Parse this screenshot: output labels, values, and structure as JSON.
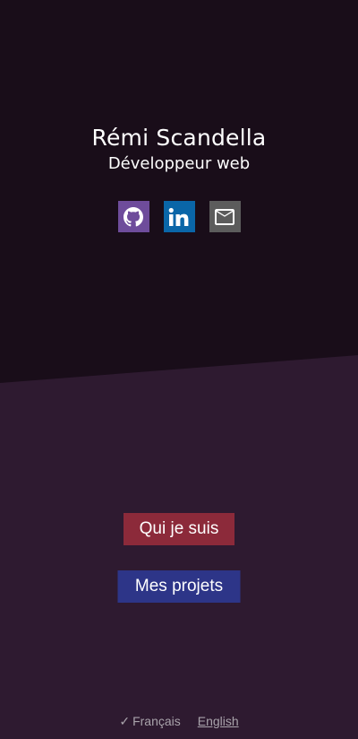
{
  "colors": {
    "page_background": "#2e1a30",
    "hero_background": "#190d19",
    "github": "#6e4c9b",
    "linkedin": "#0a66a8",
    "email": "#5c5c5c",
    "about_button": "#8c2a3a",
    "projects_button": "#2d3588",
    "muted_text": "#a9a3ab"
  },
  "header": {
    "name": "Rémi Scandella",
    "role": "Développeur web"
  },
  "socials": [
    {
      "icon": "github-icon"
    },
    {
      "icon": "linkedin-icon"
    },
    {
      "icon": "email-icon"
    }
  ],
  "nav": {
    "about_label": "Qui je suis",
    "projects_label": "Mes projets"
  },
  "language": {
    "current_check": "✓",
    "current": "Français",
    "other": "English"
  }
}
